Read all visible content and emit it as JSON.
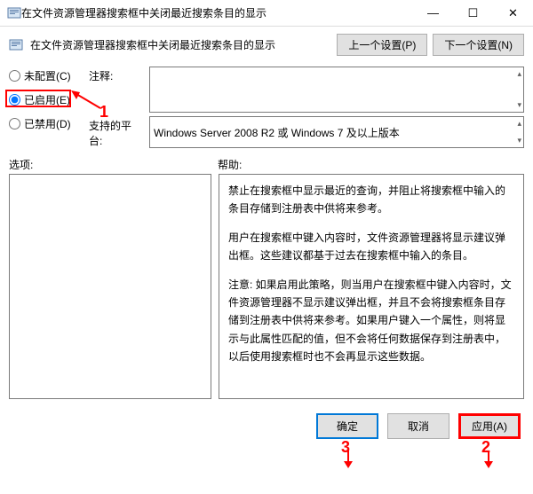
{
  "window": {
    "title": "在文件资源管理器搜索框中关闭最近搜索条目的显示",
    "minimize": "—",
    "maximize": "☐",
    "close": "✕"
  },
  "subheader": {
    "title": "在文件资源管理器搜索框中关闭最近搜索条目的显示"
  },
  "nav": {
    "prev": "上一个设置(P)",
    "next": "下一个设置(N)"
  },
  "radios": {
    "notConfigured": "未配置(C)",
    "enabled": "已启用(E)",
    "disabled": "已禁用(D)"
  },
  "fields": {
    "commentLabel": "注释:",
    "commentValue": "",
    "supportedLabel": "支持的平台:",
    "supportedValue": "Windows Server 2008 R2 或 Windows 7 及以上版本"
  },
  "sections": {
    "options": "选项:",
    "help": "帮助:"
  },
  "help": {
    "p1": "禁止在搜索框中显示最近的查询，并阻止将搜索框中输入的条目存储到注册表中供将来参考。",
    "p2": "用户在搜索框中键入内容时，文件资源管理器将显示建议弹出框。这些建议都基于过去在搜索框中输入的条目。",
    "p3": "注意: 如果启用此策略，则当用户在搜索框中键入内容时，文件资源管理器不显示建议弹出框，并且不会将搜索框条目存储到注册表中供将来参考。如果用户键入一个属性，则将显示与此属性匹配的值，但不会将任何数据保存到注册表中，以后使用搜索框时也不会再显示这些数据。"
  },
  "buttons": {
    "ok": "确定",
    "cancel": "取消",
    "apply": "应用(A)"
  },
  "annotations": {
    "one": "1",
    "two": "2",
    "three": "3"
  }
}
